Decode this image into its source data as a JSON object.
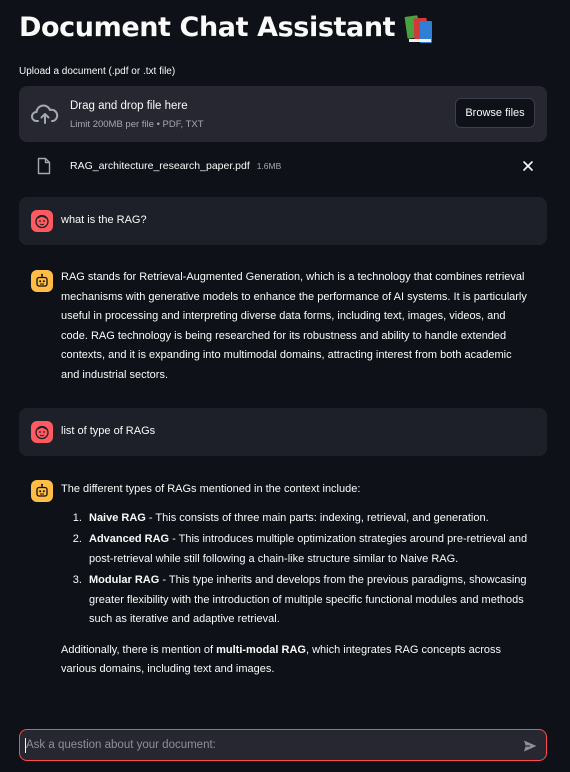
{
  "header": {
    "title": "Document Chat Assistant",
    "title_icon": "books-icon"
  },
  "uploader": {
    "label": "Upload a document (.pdf or .txt file)",
    "dropzone_title": "Drag and drop file here",
    "dropzone_limit": "Limit 200MB per file • PDF, TXT",
    "browse_label": "Browse files",
    "file": {
      "name": "RAG_architecture_research_paper.pdf",
      "size": "1.6MB"
    }
  },
  "colors": {
    "background": "#0e1117",
    "accent": "#ff4b4b",
    "user_avatar": "#ff5a5f",
    "assistant_avatar": "#ffbd45"
  },
  "messages": {
    "q1": "what is the RAG?",
    "a1": "RAG stands for Retrieval-Augmented Generation, which is a technology that combines retrieval mechanisms with generative models to enhance the performance of AI systems. It is particularly useful in processing and interpreting diverse data forms, including text, images, videos, and code. RAG technology is being researched for its robustness and ability to handle extended contexts, and it is expanding into multimodal domains, attracting interest from both academic and industrial sectors.",
    "q2": "list of type of RAGs",
    "a2": {
      "intro": "The different types of RAGs mentioned in the context include:",
      "items": [
        {
          "name": "Naive RAG",
          "desc": " - This consists of three main parts: indexing, retrieval, and generation."
        },
        {
          "name": "Advanced RAG",
          "desc": " - This introduces multiple optimization strategies around pre-retrieval and post-retrieval while still following a chain-like structure similar to Naive RAG."
        },
        {
          "name": "Modular RAG",
          "desc": " - This type inherits and develops from the previous paradigms, showcasing greater flexibility with the introduction of multiple specific functional modules and methods such as iterative and adaptive retrieval."
        }
      ],
      "outro_pre": "Additionally, there is mention of ",
      "outro_bold": "multi-modal RAG",
      "outro_post": ", which integrates RAG concepts across various domains, including text and images."
    }
  },
  "chat_input": {
    "placeholder": "Ask a question about your document:"
  }
}
